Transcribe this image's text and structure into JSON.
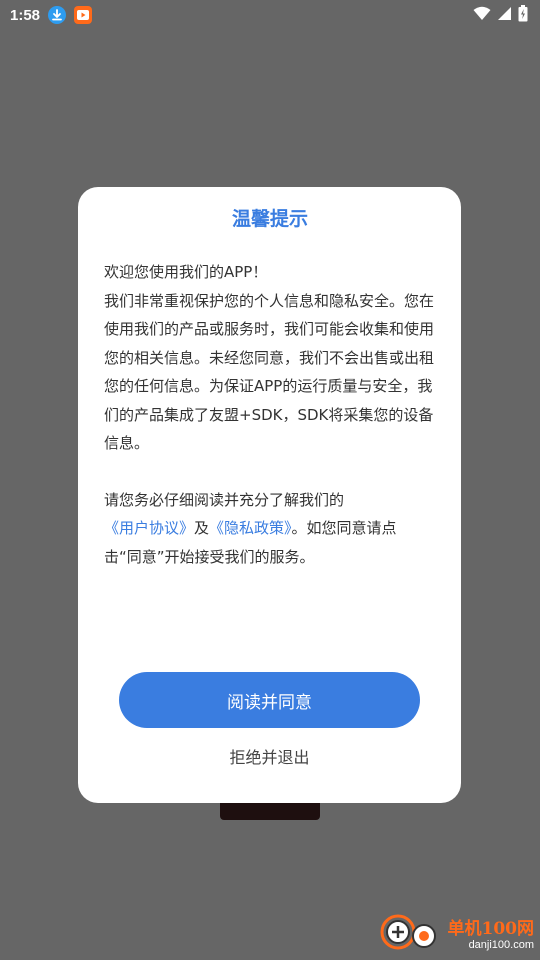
{
  "status_bar": {
    "time": "1:58",
    "icons": [
      "download-icon",
      "video-app-icon",
      "wifi-icon",
      "signal-icon",
      "battery-charging-icon"
    ]
  },
  "dialog": {
    "title": "温馨提示",
    "paragraph1": "欢迎您使用我们的APP！\n我们非常重视保护您的个人信息和隐私安全。您在使用我们的产品或服务时，我们可能会收集和使用您的相关信息。未经您同意，我们不会出售或出租您的任何信息。为保证APP的运行质量与安全，我们的产品集成了友盟+SDK，SDK将采集您的设备信息。",
    "paragraph2": {
      "prefix": "请您务必仔细阅读并充分了解我们的",
      "user_agreement_link": "《用户协议》",
      "and": "及",
      "privacy_policy_link": "《隐私政策》",
      "suffix": "。如您同意请点击“同意”开始接受我们的服务。"
    },
    "agree_button": "阅读并同意",
    "reject_button": "拒绝并退出"
  },
  "watermark": {
    "brand": "单机100网",
    "url": "danji100.com"
  },
  "colors": {
    "accent": "#3a7de0",
    "overlay": "#666666",
    "watermark": "#ff6a1a"
  }
}
